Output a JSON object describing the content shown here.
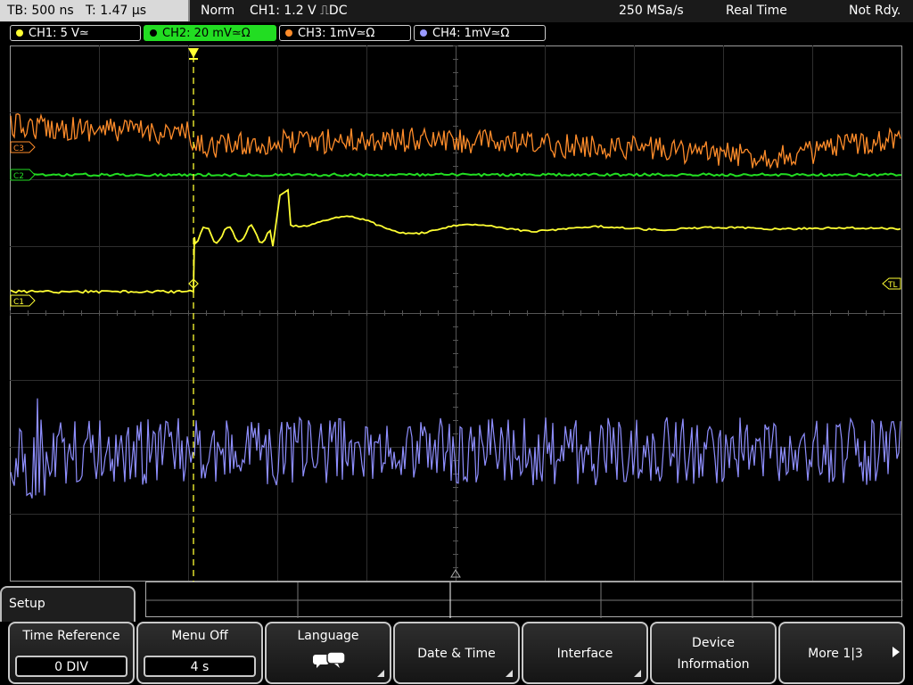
{
  "topbar": {
    "timebase": "TB: 500 ns",
    "trigger_time": "T: 1.47 µs",
    "mode": "Norm",
    "trigger": "CH1: 1.2 V ⎍DC",
    "sample_rate": "250 MSa/s",
    "acq_mode": "Real Time",
    "status": "Not Rdy."
  },
  "channels": [
    {
      "label": "CH1: 5 V≃",
      "color": "#ffff33"
    },
    {
      "label": "CH2: 20 mV≃Ω",
      "color": "#22dd22"
    },
    {
      "label": "CH3: 1mV≃Ω",
      "color": "#ff8c2a"
    },
    {
      "label": "CH4: 1mV≃Ω",
      "color": "#9999ff"
    }
  ],
  "markers": {
    "c1": "C1",
    "c2": "C2",
    "c3": "C3",
    "trigger_level": "TL"
  },
  "menu": {
    "title": "Setup",
    "softkeys": [
      {
        "label": "Time Reference",
        "value": "0 DIV"
      },
      {
        "label": "Menu Off",
        "value": "4 s"
      },
      {
        "label": "Language",
        "icon": "speech-bubbles-icon"
      },
      {
        "label": "Date & Time"
      },
      {
        "label": "Interface"
      },
      {
        "label_line1": "Device",
        "label_line2": "Information"
      },
      {
        "label": "More 1|3"
      }
    ]
  }
}
